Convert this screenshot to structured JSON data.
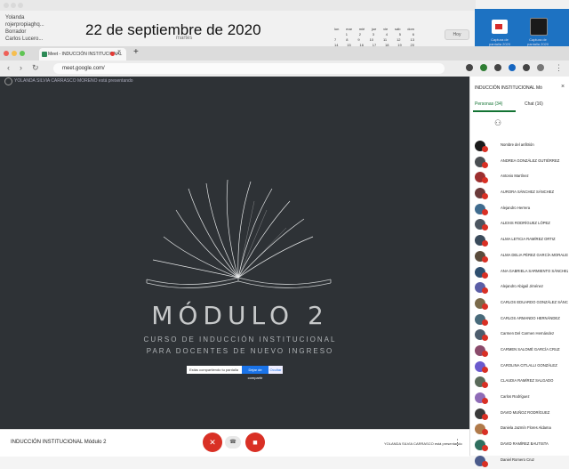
{
  "desktop": {
    "mail_items": [
      "Yolanda",
      "rojerpropiaghq...",
      "Borrador",
      "Carlos Lucero..."
    ],
    "date_title": "22 de septiembre de 2020",
    "date_sub": "martes",
    "calendar_rows": [
      [
        "lun",
        "mar",
        "mié",
        "jue",
        "vie",
        "sáb",
        "dom"
      ],
      [
        "",
        "1",
        "2",
        "3",
        "4",
        "5",
        "6"
      ],
      [
        "7",
        "8",
        "9",
        "10",
        "11",
        "12",
        "13"
      ],
      [
        "14",
        "15",
        "16",
        "17",
        "18",
        "19",
        "20"
      ]
    ],
    "calendar_button": "Hoy",
    "desktop_icons": [
      "Captura de pantalla 2020",
      "Captura de pantalla 2020"
    ]
  },
  "browser": {
    "tab_title": "Meet - INDUCCIÓN INSTITUCIONAL",
    "url": "meet.google.com/",
    "new_tab": "+",
    "close": "×"
  },
  "stage": {
    "banner": "YOLANDA SILVIA CARRASCO MORENO está presentando",
    "slide_title": "MÓDULO 2",
    "slide_subtitle_1": "CURSO DE INDUCCIÓN INSTITUCIONAL",
    "slide_subtitle_2": "PARA DOCENTES DE NUEVO INGRESO",
    "share_notice": "Estás compartiendo tu pantalla",
    "share_stop": "Dejar de compartir",
    "share_hide": "Ocultar"
  },
  "bottom": {
    "meeting_name": "INDUCCIÓN INSTITUCIONAL Módulo 2",
    "presenting": "YOLANDA SILVIA CARRASCO está presentando",
    "more": "⋮"
  },
  "sidebar": {
    "title": "INDUCCIÓN INSTITUCIONAL Mó",
    "tab_people": "Personas (34)",
    "tab_chat": "Chat (16)",
    "participants": [
      "Nombre del anfitrión",
      "ANDREA GONZÁLEZ GUTIÉRREZ",
      "Antonio Martínez",
      "AURORA SÁNCHEZ SÁNCHEZ",
      "Alejandro Herrera",
      "ALEXIS RODRÍGUEZ LÓPEZ",
      "ALMA LETICIA RAMÍREZ ORTIZ",
      "ALMA DELIA PÉREZ GARCÍA MORALES",
      "ANA GABRIELA SARMIENTO SÁNCHEZ",
      "Alejandro Abigail Jiménez",
      "CARLOS EDUARDO GONZÁLEZ SÁNCHEZ",
      "CARLOS ARMANDO HERNÁNDEZ",
      "Carmen Del Carmen Hernández",
      "CARMEN SALOMÉ GARCÍA CRUZ",
      "CAROLINA CITLALLI GONZÁLEZ",
      "CLAUDIA RAMÍREZ SALGADO",
      "Carlos Rodríguez",
      "DAVID MUÑOZ RODRÍGUEZ",
      "Daniela Jazmín Flores Aldama",
      "DAVID RAMÍREZ BAUTISTA",
      "Daniel Romero Cruz"
    ],
    "avatar_colors": [
      "#1a1a1a",
      "#4a4e52",
      "#9c2f2f",
      "#6b3a3a",
      "#3f6b8e",
      "#4c5560",
      "#3a4a5a",
      "#5a4b3b",
      "#2f4f6f",
      "#5b5ea6",
      "#7a6a4a",
      "#486a7a",
      "#4d5d6d",
      "#8a4a6a",
      "#6a5acd",
      "#5a6a5a",
      "#8e6bb6",
      "#3a3a3a",
      "#b07a4a",
      "#2f6f5f",
      "#4a5a8a"
    ]
  }
}
